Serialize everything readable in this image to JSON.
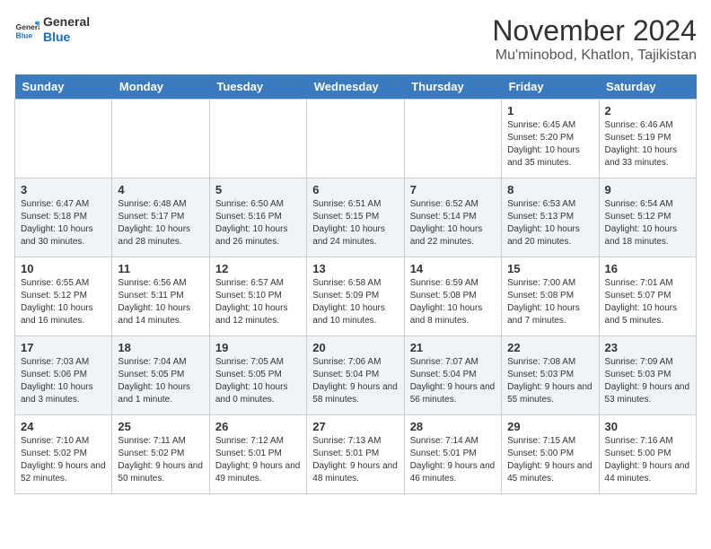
{
  "header": {
    "logo_line1": "General",
    "logo_line2": "Blue",
    "title": "November 2024",
    "subtitle": "Mu'minobod, Khatlon, Tajikistan"
  },
  "days_of_week": [
    "Sunday",
    "Monday",
    "Tuesday",
    "Wednesday",
    "Thursday",
    "Friday",
    "Saturday"
  ],
  "weeks": [
    {
      "days": [
        {
          "num": "",
          "content": ""
        },
        {
          "num": "",
          "content": ""
        },
        {
          "num": "",
          "content": ""
        },
        {
          "num": "",
          "content": ""
        },
        {
          "num": "",
          "content": ""
        },
        {
          "num": "1",
          "content": "Sunrise: 6:45 AM\nSunset: 5:20 PM\nDaylight: 10 hours and 35 minutes."
        },
        {
          "num": "2",
          "content": "Sunrise: 6:46 AM\nSunset: 5:19 PM\nDaylight: 10 hours and 33 minutes."
        }
      ]
    },
    {
      "days": [
        {
          "num": "3",
          "content": "Sunrise: 6:47 AM\nSunset: 5:18 PM\nDaylight: 10 hours and 30 minutes."
        },
        {
          "num": "4",
          "content": "Sunrise: 6:48 AM\nSunset: 5:17 PM\nDaylight: 10 hours and 28 minutes."
        },
        {
          "num": "5",
          "content": "Sunrise: 6:50 AM\nSunset: 5:16 PM\nDaylight: 10 hours and 26 minutes."
        },
        {
          "num": "6",
          "content": "Sunrise: 6:51 AM\nSunset: 5:15 PM\nDaylight: 10 hours and 24 minutes."
        },
        {
          "num": "7",
          "content": "Sunrise: 6:52 AM\nSunset: 5:14 PM\nDaylight: 10 hours and 22 minutes."
        },
        {
          "num": "8",
          "content": "Sunrise: 6:53 AM\nSunset: 5:13 PM\nDaylight: 10 hours and 20 minutes."
        },
        {
          "num": "9",
          "content": "Sunrise: 6:54 AM\nSunset: 5:12 PM\nDaylight: 10 hours and 18 minutes."
        }
      ]
    },
    {
      "days": [
        {
          "num": "10",
          "content": "Sunrise: 6:55 AM\nSunset: 5:12 PM\nDaylight: 10 hours and 16 minutes."
        },
        {
          "num": "11",
          "content": "Sunrise: 6:56 AM\nSunset: 5:11 PM\nDaylight: 10 hours and 14 minutes."
        },
        {
          "num": "12",
          "content": "Sunrise: 6:57 AM\nSunset: 5:10 PM\nDaylight: 10 hours and 12 minutes."
        },
        {
          "num": "13",
          "content": "Sunrise: 6:58 AM\nSunset: 5:09 PM\nDaylight: 10 hours and 10 minutes."
        },
        {
          "num": "14",
          "content": "Sunrise: 6:59 AM\nSunset: 5:08 PM\nDaylight: 10 hours and 8 minutes."
        },
        {
          "num": "15",
          "content": "Sunrise: 7:00 AM\nSunset: 5:08 PM\nDaylight: 10 hours and 7 minutes."
        },
        {
          "num": "16",
          "content": "Sunrise: 7:01 AM\nSunset: 5:07 PM\nDaylight: 10 hours and 5 minutes."
        }
      ]
    },
    {
      "days": [
        {
          "num": "17",
          "content": "Sunrise: 7:03 AM\nSunset: 5:06 PM\nDaylight: 10 hours and 3 minutes."
        },
        {
          "num": "18",
          "content": "Sunrise: 7:04 AM\nSunset: 5:05 PM\nDaylight: 10 hours and 1 minute."
        },
        {
          "num": "19",
          "content": "Sunrise: 7:05 AM\nSunset: 5:05 PM\nDaylight: 10 hours and 0 minutes."
        },
        {
          "num": "20",
          "content": "Sunrise: 7:06 AM\nSunset: 5:04 PM\nDaylight: 9 hours and 58 minutes."
        },
        {
          "num": "21",
          "content": "Sunrise: 7:07 AM\nSunset: 5:04 PM\nDaylight: 9 hours and 56 minutes."
        },
        {
          "num": "22",
          "content": "Sunrise: 7:08 AM\nSunset: 5:03 PM\nDaylight: 9 hours and 55 minutes."
        },
        {
          "num": "23",
          "content": "Sunrise: 7:09 AM\nSunset: 5:03 PM\nDaylight: 9 hours and 53 minutes."
        }
      ]
    },
    {
      "days": [
        {
          "num": "24",
          "content": "Sunrise: 7:10 AM\nSunset: 5:02 PM\nDaylight: 9 hours and 52 minutes."
        },
        {
          "num": "25",
          "content": "Sunrise: 7:11 AM\nSunset: 5:02 PM\nDaylight: 9 hours and 50 minutes."
        },
        {
          "num": "26",
          "content": "Sunrise: 7:12 AM\nSunset: 5:01 PM\nDaylight: 9 hours and 49 minutes."
        },
        {
          "num": "27",
          "content": "Sunrise: 7:13 AM\nSunset: 5:01 PM\nDaylight: 9 hours and 48 minutes."
        },
        {
          "num": "28",
          "content": "Sunrise: 7:14 AM\nSunset: 5:01 PM\nDaylight: 9 hours and 46 minutes."
        },
        {
          "num": "29",
          "content": "Sunrise: 7:15 AM\nSunset: 5:00 PM\nDaylight: 9 hours and 45 minutes."
        },
        {
          "num": "30",
          "content": "Sunrise: 7:16 AM\nSunset: 5:00 PM\nDaylight: 9 hours and 44 minutes."
        }
      ]
    }
  ]
}
